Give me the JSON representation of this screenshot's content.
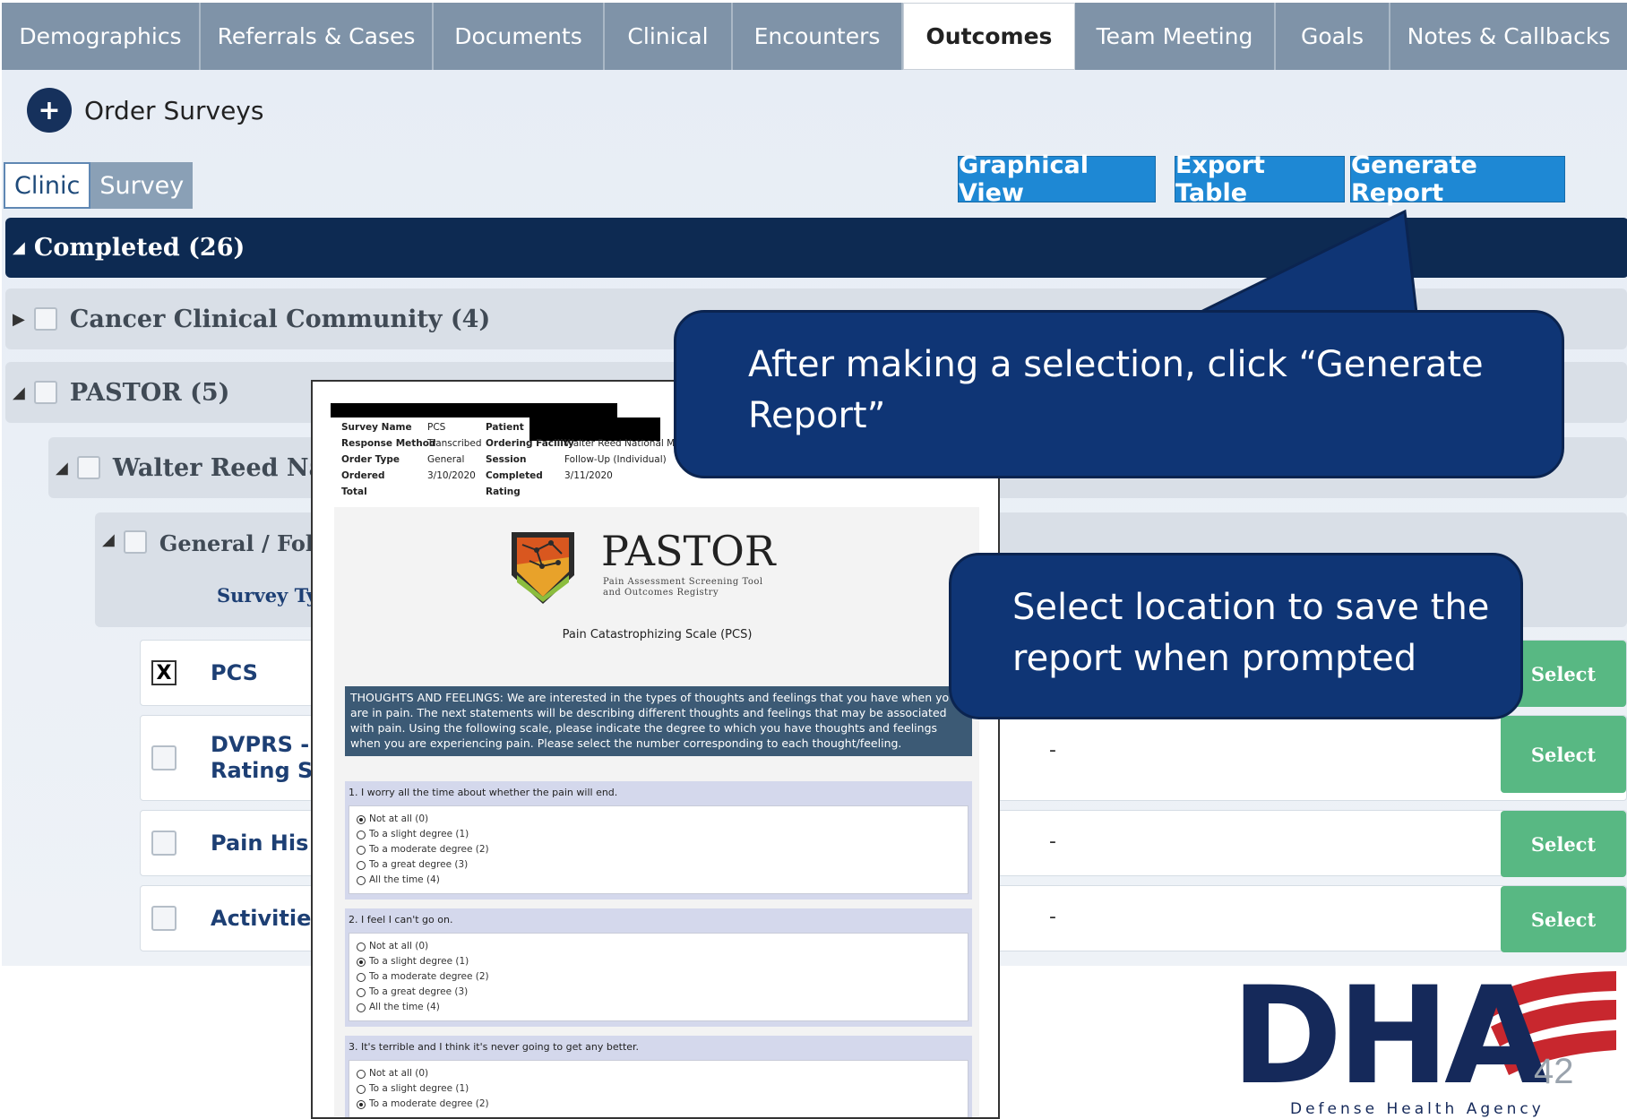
{
  "tabs": [
    "Demographics",
    "Referrals & Cases",
    "Documents",
    "Clinical",
    "Encounters",
    "Outcomes",
    "Team Meeting",
    "Goals",
    "Notes & Callbacks"
  ],
  "active_tab": "Outcomes",
  "order_surveys": {
    "icon": "plus-icon",
    "label": "Order Surveys"
  },
  "view_toggle": [
    "Clinic",
    "Survey"
  ],
  "actions": {
    "graphical": "Graphical View",
    "export": "Export Table",
    "generate": "Generate Report"
  },
  "completed_header": "Completed (26)",
  "groups": {
    "cancer": "Cancer Clinical Community (4)",
    "pastor": "PASTOR (5)",
    "walter": "Walter Reed Nati",
    "general": "General / Follo",
    "survey_type": "Survey Typ"
  },
  "rows": [
    {
      "name": "PCS",
      "checked": true,
      "dash": "",
      "select": "Select"
    },
    {
      "name1": "DVPRS -",
      "name2": "Rating S",
      "dash": "-",
      "select": "Select"
    },
    {
      "name": "Pain His",
      "dash": "-",
      "select": "Select"
    },
    {
      "name": "Activitie",
      "dash": "-",
      "select": "Select"
    }
  ],
  "row_check_mark": "X",
  "report": {
    "meta": {
      "survey_name_label": "Survey Name",
      "survey_name": "PCS",
      "response_method_label": "Response Method",
      "response_method": "Transcribed",
      "order_type_label": "Order Type",
      "order_type": "General",
      "ordered_label": "Ordered",
      "ordered": "3/10/2020",
      "total_label": "Total",
      "patient_label": "Patient",
      "ordering_facility_label": "Ordering Facility",
      "ordering_facility": "Walter Reed National Mil",
      "session_label": "Session",
      "session": "Follow-Up (Individual)",
      "completed_label": "Completed",
      "completed": "3/11/2020",
      "rating_label": "Rating"
    },
    "logo_title": "PASTOR",
    "logo_sub1": "Pain Assessment Screening Tool",
    "logo_sub2": "and Outcomes Registry",
    "scale_title": "Pain Catastrophizing Scale (PCS)",
    "instructions": "THOUGHTS AND FEELINGS: We are interested in the types of thoughts and feelings that you have when yo are in pain. The next statements will be describing different thoughts and feelings that may be associated with pain. Using the following scale, please indicate the degree to which you have thoughts and feelings when you are experiencing pain. Please select the number corresponding to each thought/feeling.",
    "questions": [
      {
        "text": "1. I worry all the time about whether the pain will end.",
        "selected": 0,
        "options": [
          "Not at all (0)",
          "To a slight degree (1)",
          "To a moderate degree (2)",
          "To a great degree (3)",
          "All the time (4)"
        ]
      },
      {
        "text": "2. I feel I can't go on.",
        "selected": 1,
        "options": [
          "Not at all (0)",
          "To a slight degree (1)",
          "To a moderate degree (2)",
          "To a great degree (3)",
          "All the time (4)"
        ]
      },
      {
        "text": "3. It's terrible and I think it's never going to get any better.",
        "selected": 2,
        "options": [
          "Not at all (0)",
          "To a slight degree (1)",
          "To a moderate degree (2)"
        ]
      }
    ]
  },
  "callouts": {
    "generate": "After making a selection, click “Generate Report”",
    "save": "Select location to save the report when prompted"
  },
  "dha_logo": {
    "text": "DHA",
    "subtitle": "Defense Health Agency",
    "colors": {
      "navy": "#15295a",
      "red": "#c8272e"
    }
  },
  "slide_number": "42"
}
